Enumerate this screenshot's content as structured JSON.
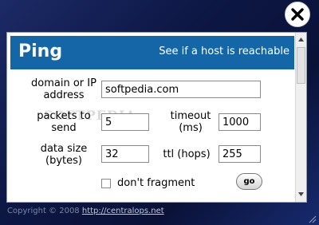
{
  "header": {
    "title": "Ping",
    "subtitle": "See if a host is reachable"
  },
  "form": {
    "domain": {
      "label_line1": "domain or IP",
      "label_line2": "address",
      "value": "softpedia.com"
    },
    "packets": {
      "label_line1": "packets to",
      "label_line2": "send",
      "value": "5"
    },
    "timeout": {
      "label_line1": "timeout",
      "label_line2": "(ms)",
      "value": "1000"
    },
    "data_size": {
      "label_line1": "data size",
      "label_line2": "(bytes)",
      "value": "32"
    },
    "ttl": {
      "label": "ttl (hops)",
      "value": "255"
    },
    "dont_fragment": {
      "label": "don't fragment",
      "checked": false
    },
    "go_label": "go"
  },
  "footer": {
    "copyright": "Copyright © 2008",
    "link": "http://centralops.net"
  },
  "watermark": "SOFTPEDIA",
  "icons": {
    "close": "close-icon",
    "scroll_up": "arrow-up-icon",
    "scroll_down": "arrow-down-icon",
    "resize": "resize-grip-icon"
  },
  "colors": {
    "header_bg": "#1566a6",
    "window_bg": "#0d1744",
    "panel_bg": "#ffffff"
  }
}
